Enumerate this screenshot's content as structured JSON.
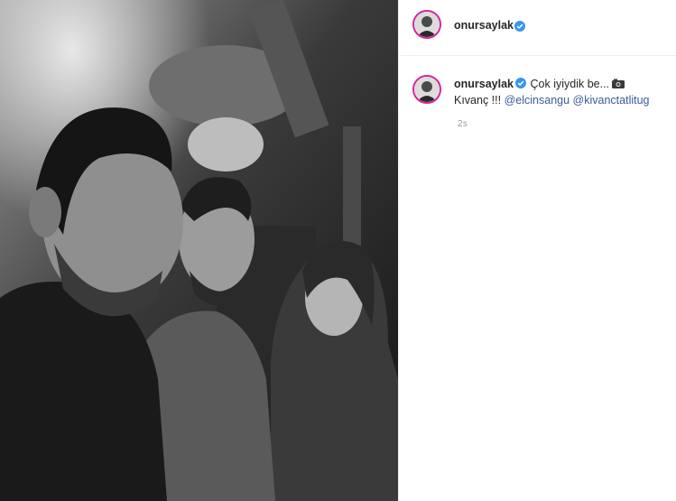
{
  "post": {
    "username": "onursaylak",
    "caption_line1": "Çok iyiydik be...",
    "caption_line2": "Kıvanç !!!",
    "mention_1": "@elcinsangu",
    "mention_2": "@kivanctatlitug",
    "time": "2s"
  },
  "icons": {
    "verified": "verified-badge-icon",
    "camera": "camera-emoji-icon"
  },
  "colors": {
    "verified": "#3897f0",
    "mention": "#3a5a9c",
    "text": "#262626",
    "time": "#999999",
    "avatar_ring": "#d6249f"
  }
}
